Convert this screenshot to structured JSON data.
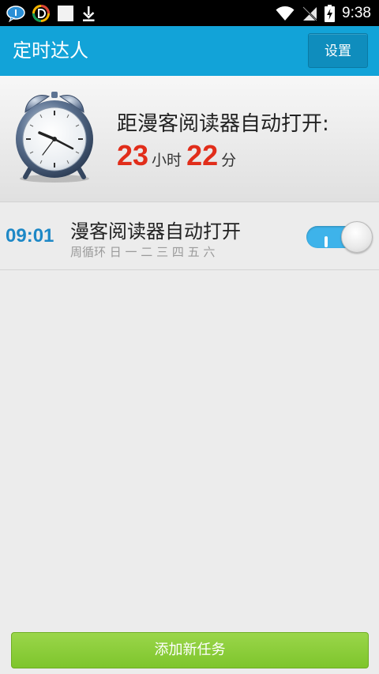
{
  "status_bar": {
    "time": "9:38",
    "icons_left": [
      "chat-bubble-icon",
      "d-circle-icon",
      "white-square-icon",
      "download-icon"
    ],
    "icons_right": [
      "wifi-icon",
      "no-signal-icon",
      "battery-charging-icon"
    ]
  },
  "app_bar": {
    "title": "定时达人",
    "settings_label": "设置",
    "color": "#12a3d8"
  },
  "countdown": {
    "title": "距漫客阅读器自动打开:",
    "hours": "23",
    "hours_unit": "小时",
    "minutes": "22",
    "minutes_unit": "分",
    "number_color": "#e12d1a"
  },
  "tasks": [
    {
      "time": "09:01",
      "title": "漫客阅读器自动打开",
      "repeat": "周循环 日 一 二 三 四 五 六",
      "enabled": true
    }
  ],
  "footer": {
    "add_label": "添加新任务",
    "color": "#8ccd3a"
  }
}
